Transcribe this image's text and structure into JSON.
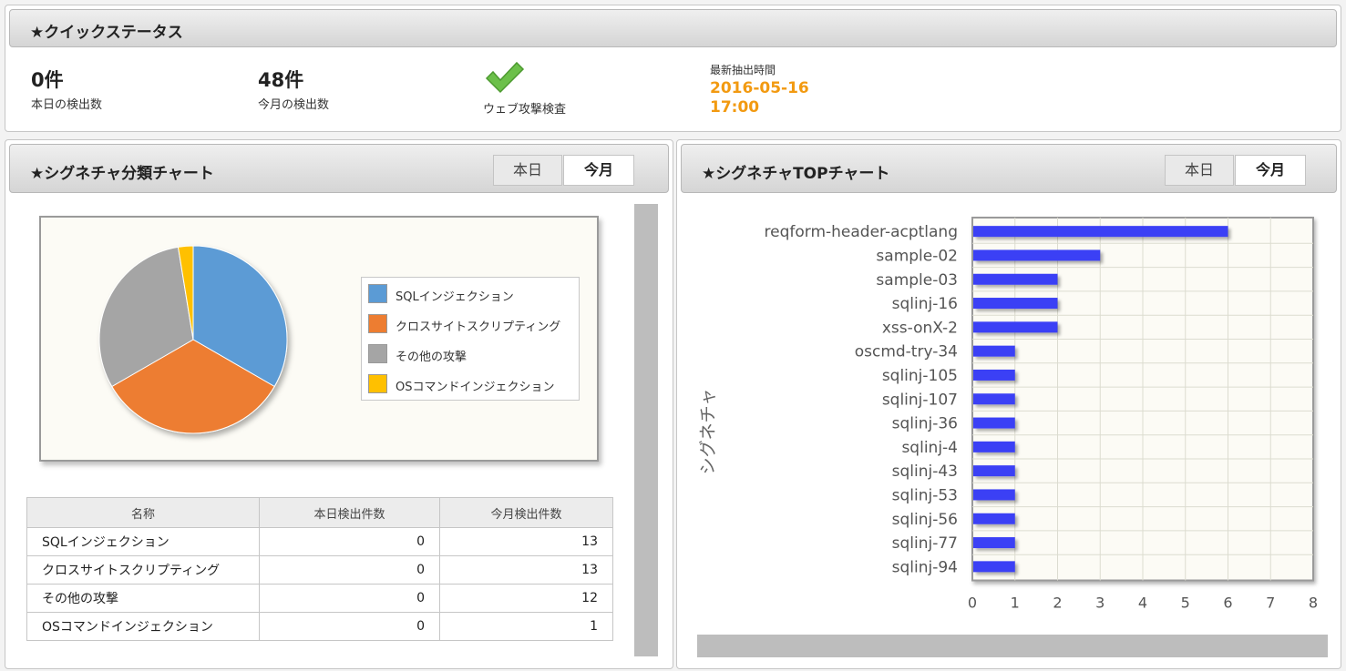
{
  "quick_status": {
    "title": "★クイックステータス",
    "today_count": "0件",
    "today_label": "本日の検出数",
    "month_count": "48件",
    "month_label": "今月の検出数",
    "check_label": "ウェブ攻撃検査",
    "latest_label": "最新抽出時間",
    "latest_date": "2016-05-16",
    "latest_time": "17:00"
  },
  "category_chart": {
    "title": "★シグネチャ分類チャート",
    "tabs": [
      "本日",
      "今月"
    ],
    "active_tab": "今月",
    "table": {
      "headers": [
        "名称",
        "本日検出件数",
        "今月検出件数"
      ],
      "rows": [
        [
          "SQLインジェクション",
          "0",
          "13"
        ],
        [
          "クロスサイトスクリプティング",
          "0",
          "13"
        ],
        [
          "その他の攻撃",
          "0",
          "12"
        ],
        [
          "OSコマンドインジェクション",
          "0",
          "1"
        ]
      ]
    }
  },
  "top_chart": {
    "title": "★シグネチャTOPチャート",
    "tabs": [
      "本日",
      "今月"
    ],
    "active_tab": "今月"
  },
  "colors": {
    "sql": "#5b9bd5",
    "xss": "#ed7d31",
    "other": "#a5a5a5",
    "os": "#ffc000",
    "bar": "#3b3ff5",
    "accent": "#f29a11",
    "check": "#6cc04a"
  },
  "icons": {
    "check": "check-icon"
  },
  "chart_data": [
    {
      "type": "pie",
      "categories": [
        "SQLインジェクション",
        "クロスサイトスクリプティング",
        "その他の攻撃",
        "OSコマンドインジェクション"
      ],
      "values": [
        13,
        13,
        12,
        1
      ],
      "legend": "right"
    },
    {
      "type": "bar",
      "orientation": "horizontal",
      "categories": [
        "reqform-header-acptlang",
        "sample-02",
        "sample-03",
        "sqlinj-16",
        "xss-onX-2",
        "oscmd-try-34",
        "sqlinj-105",
        "sqlinj-107",
        "sqlinj-36",
        "sqlinj-4",
        "sqlinj-43",
        "sqlinj-53",
        "sqlinj-56",
        "sqlinj-77",
        "sqlinj-94"
      ],
      "values": [
        6,
        3,
        2,
        2,
        2,
        1,
        1,
        1,
        1,
        1,
        1,
        1,
        1,
        1,
        1
      ],
      "ylabel": "シグネチャ",
      "xlim": [
        0,
        8
      ],
      "xticks": [
        "0",
        "1",
        "2",
        "3",
        "4",
        "5",
        "6",
        "7",
        "8"
      ],
      "grid": true
    }
  ]
}
